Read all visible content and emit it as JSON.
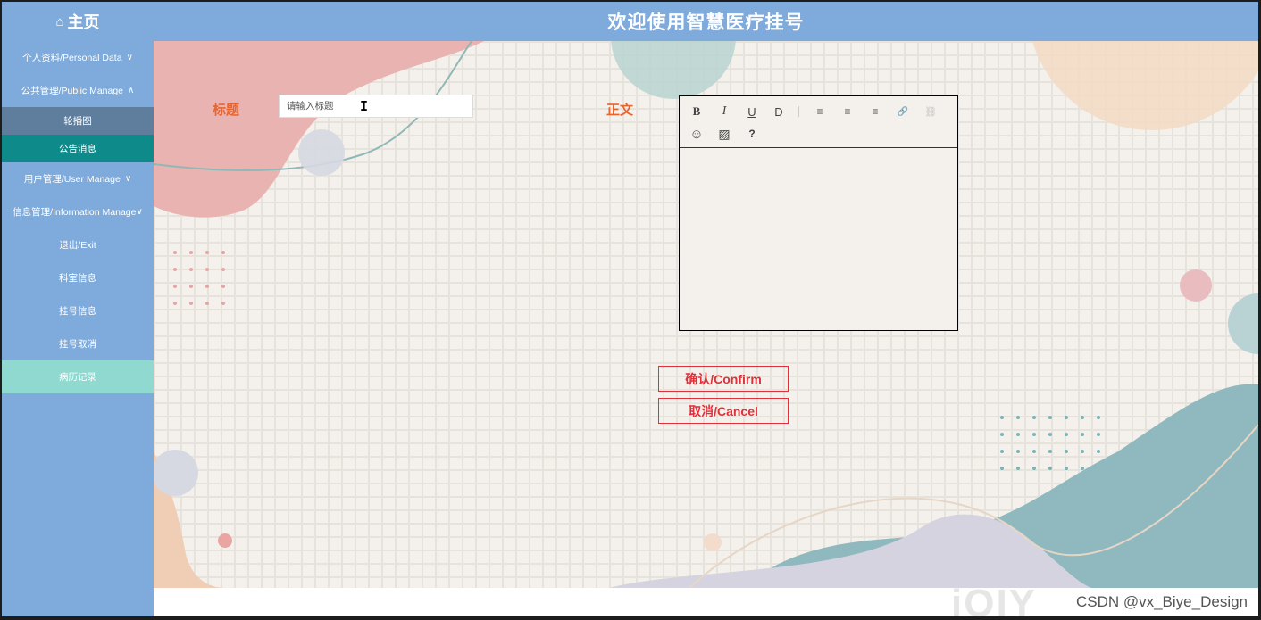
{
  "header": {
    "home_label": "主页",
    "home_icon": "home-icon",
    "site_title": "欢迎使用智慧医疗挂号",
    "color": "#7eabdb"
  },
  "sidebar": {
    "items": [
      {
        "label": "个人资料/Personal Data",
        "chevron": "chevron-down-icon"
      },
      {
        "label": "公共管理/Public Manage",
        "chevron": "chevron-up-icon"
      },
      {
        "label": "轮播图"
      },
      {
        "label": "公告消息"
      },
      {
        "label": "用户管理/User Manage",
        "chevron": "chevron-down-icon"
      },
      {
        "label": "信息管理/Information Manage",
        "chevron": "chevron-down-icon"
      },
      {
        "label": "退出/Exit"
      },
      {
        "label": "科室信息"
      },
      {
        "label": "挂号信息"
      },
      {
        "label": "挂号取消"
      },
      {
        "label": "病历记录"
      }
    ],
    "active_color": "#0f8a8a",
    "highlight_color": "#8fd9d1"
  },
  "form": {
    "title_label": "标题",
    "title_placeholder": "请输入标题",
    "body_label": "正文",
    "label_color": "#e8642f"
  },
  "editor": {
    "toolbar": [
      {
        "icon": "bold-icon",
        "glyph": "B"
      },
      {
        "icon": "italic-icon",
        "glyph": "I"
      },
      {
        "icon": "underline-icon",
        "glyph": "U"
      },
      {
        "icon": "strikethrough-icon",
        "glyph": "D"
      },
      {
        "icon": "align-left-icon",
        "glyph": "≡"
      },
      {
        "icon": "align-center-icon",
        "glyph": "≡"
      },
      {
        "icon": "align-right-icon",
        "glyph": "≡"
      },
      {
        "icon": "link-icon",
        "glyph": "🔗"
      },
      {
        "icon": "unlink-icon",
        "glyph": "⛓"
      },
      {
        "icon": "emoji-icon",
        "glyph": "☺"
      },
      {
        "icon": "image-icon",
        "glyph": "▨"
      },
      {
        "icon": "help-icon",
        "glyph": "?"
      }
    ]
  },
  "buttons": {
    "confirm": "确认/Confirm",
    "cancel": "取消/Cancel",
    "color": "#e0303a"
  },
  "watermark": "CSDN @vx_Biye_Design",
  "overlay_logo": "iQIY"
}
